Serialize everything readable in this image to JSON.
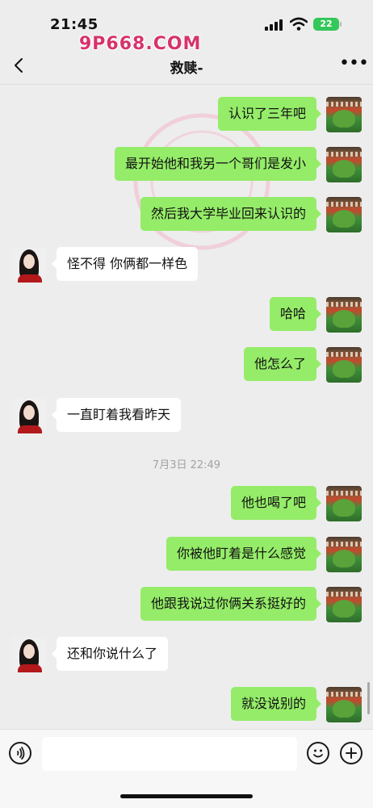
{
  "status_bar": {
    "time": "21:45",
    "battery": "22"
  },
  "watermark": "9P668.COM",
  "header": {
    "title": "救赎-"
  },
  "messages": [
    {
      "side": "me",
      "text": "认识了三年吧"
    },
    {
      "side": "me",
      "text": "最开始他和我另一个哥们是发小"
    },
    {
      "side": "me",
      "text": "然后我大学毕业回来认识的"
    },
    {
      "side": "other",
      "text": "怪不得 你俩都一样色"
    },
    {
      "side": "me",
      "text": "哈哈"
    },
    {
      "side": "me",
      "text": "他怎么了"
    },
    {
      "side": "other",
      "text": "一直盯着我看昨天"
    },
    {
      "side": "me",
      "text": "他也喝了吧"
    },
    {
      "side": "me",
      "text": "你被他盯着是什么感觉"
    },
    {
      "side": "me",
      "text": "他跟我说过你俩关系挺好的"
    },
    {
      "side": "other",
      "text": "还和你说什么了"
    },
    {
      "side": "me",
      "text": "就没说别的"
    }
  ],
  "timestamp": "7月3日 22:49",
  "colors": {
    "my_bubble": "#95ec69",
    "other_bubble": "#ffffff",
    "background": "#ededed"
  },
  "icons": {
    "back": "chevron-left-icon",
    "more": "ellipsis-icon",
    "voice": "voice-icon",
    "emoji": "emoji-icon",
    "plus": "plus-icon"
  }
}
